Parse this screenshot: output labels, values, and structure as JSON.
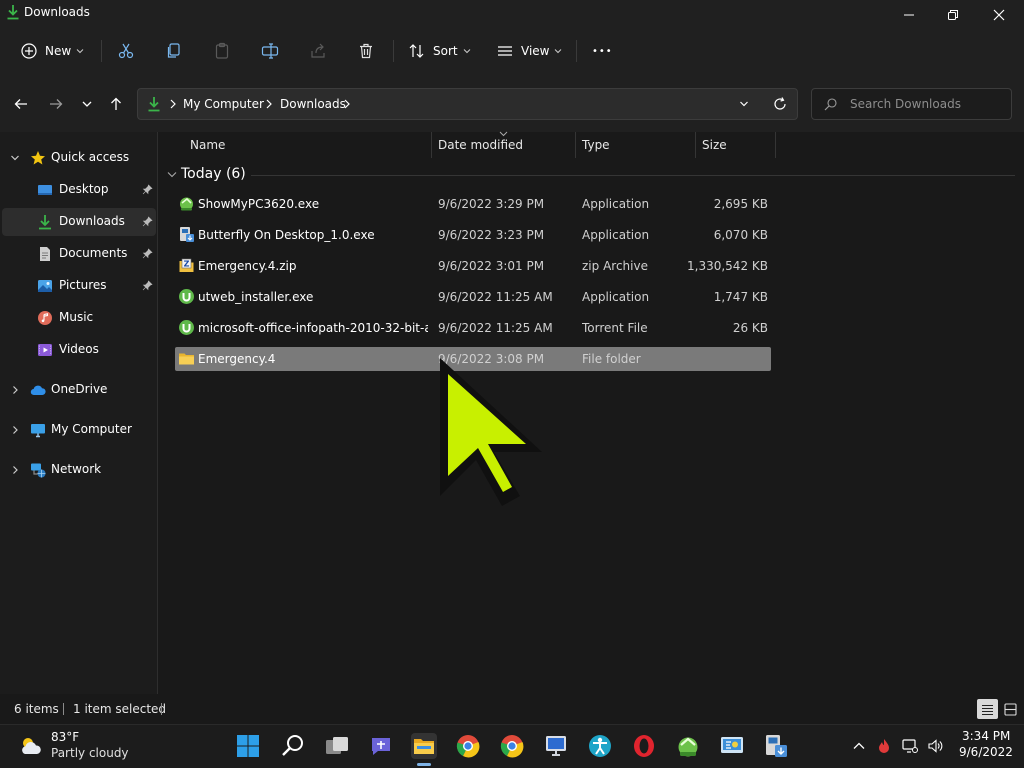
{
  "window": {
    "title": "Downloads",
    "icon": "download-arrow-icon"
  },
  "toolbar": {
    "new_label": "New",
    "sort_label": "Sort",
    "view_label": "View",
    "more_label": "•••"
  },
  "address": {
    "crumbs": [
      "My Computer",
      "Downloads"
    ],
    "search_placeholder": "Search Downloads"
  },
  "sidebar": {
    "items": [
      {
        "label": "Quick access",
        "icon": "star-icon"
      },
      {
        "label": "Desktop",
        "icon": "desktop-icon"
      },
      {
        "label": "Downloads",
        "icon": "download-arrow-icon"
      },
      {
        "label": "Documents",
        "icon": "document-icon"
      },
      {
        "label": "Pictures",
        "icon": "pictures-icon"
      },
      {
        "label": "Music",
        "icon": "music-icon"
      },
      {
        "label": "Videos",
        "icon": "videos-icon"
      },
      {
        "label": "OneDrive",
        "icon": "cloud-icon"
      },
      {
        "label": "My Computer",
        "icon": "computer-icon"
      },
      {
        "label": "Network",
        "icon": "network-icon"
      }
    ],
    "selected": "Downloads"
  },
  "columns": {
    "name": "Name",
    "date": "Date modified",
    "type": "Type",
    "size": "Size"
  },
  "group": {
    "label": "Today (6)"
  },
  "files": [
    {
      "name": "ShowMyPC3620.exe",
      "date": "9/6/2022 3:29 PM",
      "type": "Application",
      "size": "2,695 KB",
      "icon": "app-green-icon"
    },
    {
      "name": "Butterfly On Desktop_1.0.exe",
      "date": "9/6/2022 3:23 PM",
      "type": "Application",
      "size": "6,070 KB",
      "icon": "installer-icon"
    },
    {
      "name": "Emergency.4.zip",
      "date": "9/6/2022 3:01 PM",
      "type": "zip Archive",
      "size": "1,330,542 KB",
      "icon": "zip-icon"
    },
    {
      "name": "utweb_installer.exe",
      "date": "9/6/2022 11:25 AM",
      "type": "Application",
      "size": "1,747 KB",
      "icon": "utorrent-icon"
    },
    {
      "name": "microsoft-office-infopath-2010-32-bit-a...",
      "date": "9/6/2022 11:25 AM",
      "type": "Torrent File",
      "size": "26 KB",
      "icon": "utorrent-icon"
    },
    {
      "name": "Emergency.4",
      "date": "9/6/2022 3:08 PM",
      "type": "File folder",
      "size": "",
      "icon": "folder-icon"
    }
  ],
  "status": {
    "count": "6 items",
    "selection": "1 item selected"
  },
  "taskbar": {
    "weather_temp": "83°F",
    "weather_desc": "Partly cloudy",
    "time": "3:34 PM",
    "date": "9/6/2022"
  },
  "colors": {
    "accent": "#7fb3e6",
    "selection": "#7a7a7a",
    "cursor": "#c8f000"
  }
}
